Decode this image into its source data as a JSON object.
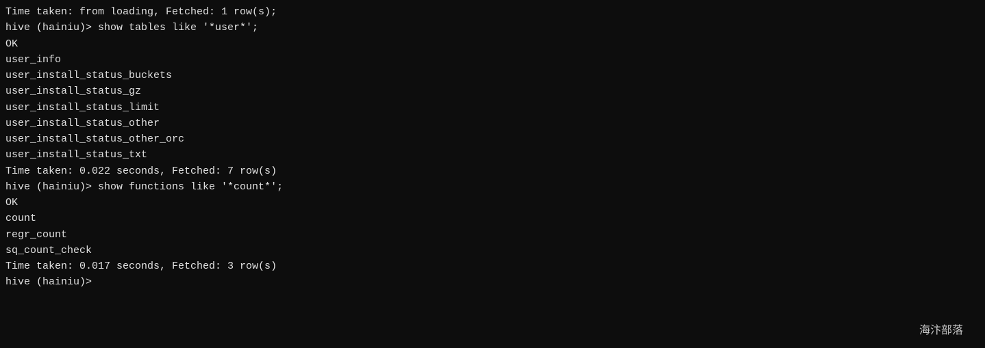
{
  "terminal": {
    "lines": [
      {
        "id": "line1",
        "text": "Time taken: from loading, Fetched: 1 row(s);",
        "type": "time"
      },
      {
        "id": "line2",
        "text": "hive (hainiu)> show tables like '*user*';",
        "type": "prompt"
      },
      {
        "id": "line3",
        "text": "OK",
        "type": "ok"
      },
      {
        "id": "line4",
        "text": "user_info",
        "type": "data"
      },
      {
        "id": "line5",
        "text": "user_install_status_buckets",
        "type": "data"
      },
      {
        "id": "line6",
        "text": "user_install_status_gz",
        "type": "data"
      },
      {
        "id": "line7",
        "text": "user_install_status_limit",
        "type": "data"
      },
      {
        "id": "line8",
        "text": "user_install_status_other",
        "type": "data"
      },
      {
        "id": "line9",
        "text": "user_install_status_other_orc",
        "type": "data"
      },
      {
        "id": "line10",
        "text": "user_install_status_txt",
        "type": "data"
      },
      {
        "id": "line11",
        "text": "Time taken: 0.022 seconds, Fetched: 7 row(s)",
        "type": "time"
      },
      {
        "id": "line12",
        "text": "hive (hainiu)> show functions like '*count*';",
        "type": "prompt"
      },
      {
        "id": "line13",
        "text": "OK",
        "type": "ok"
      },
      {
        "id": "line14",
        "text": "count",
        "type": "data"
      },
      {
        "id": "line15",
        "text": "regr_count",
        "type": "data"
      },
      {
        "id": "line16",
        "text": "sq_count_check",
        "type": "data"
      },
      {
        "id": "line17",
        "text": "Time taken: 0.017 seconds, Fetched: 3 row(s)",
        "type": "time"
      },
      {
        "id": "line18",
        "text": "hive (hainiu)>",
        "type": "prompt"
      }
    ],
    "watermark": "海汴部落"
  }
}
